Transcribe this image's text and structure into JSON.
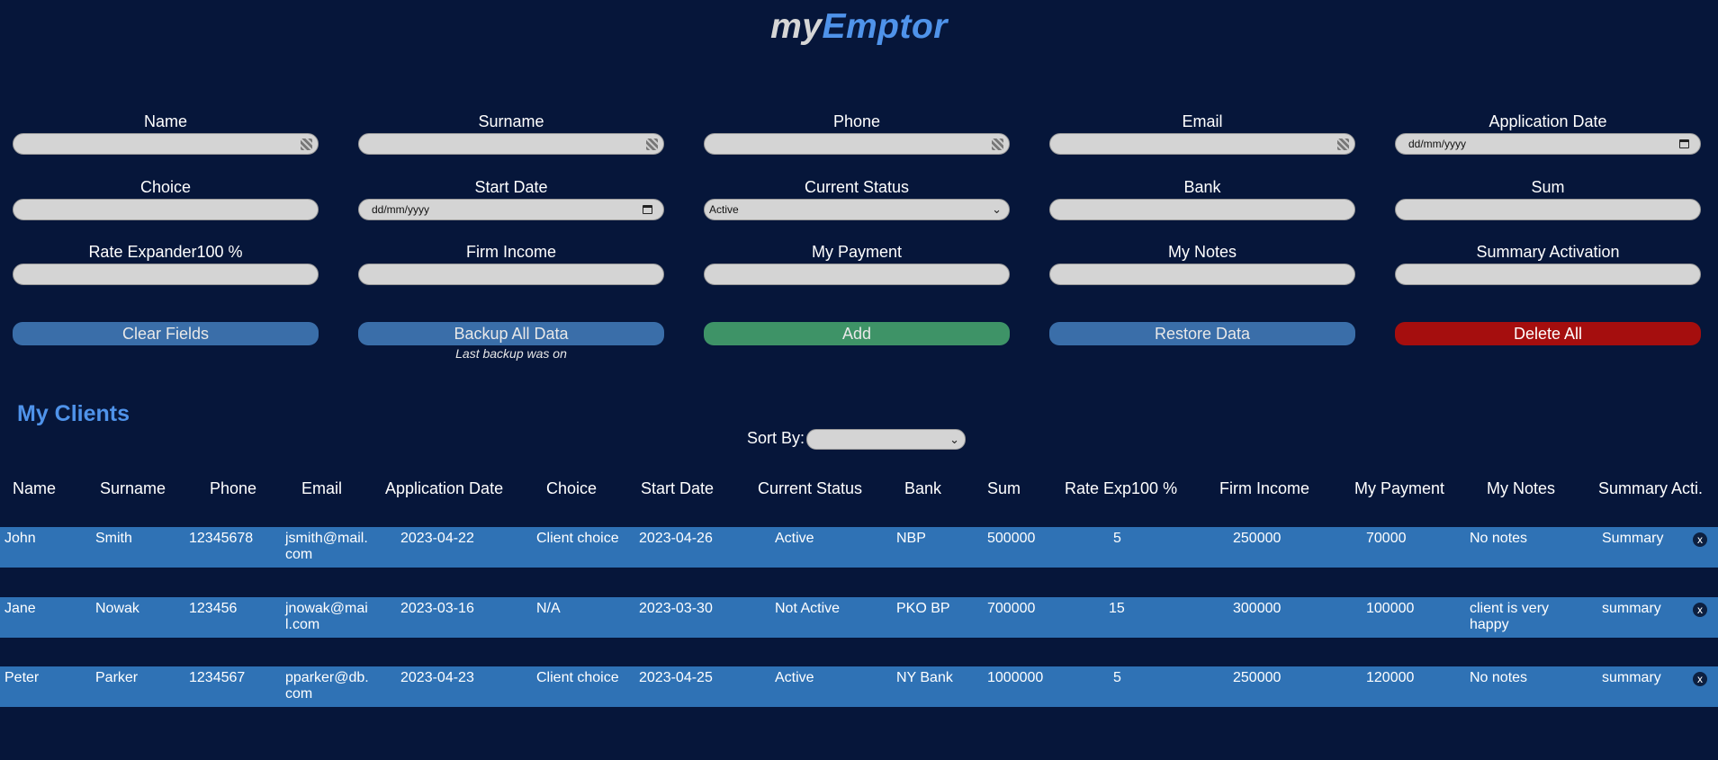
{
  "app": {
    "title_my": "my",
    "title_emptor": "Emptor"
  },
  "form": {
    "fields": [
      {
        "label": "Name",
        "value": "",
        "kind": "autofill"
      },
      {
        "label": "Surname",
        "value": "",
        "kind": "autofill"
      },
      {
        "label": "Phone",
        "value": "",
        "kind": "autofill"
      },
      {
        "label": "Email",
        "value": "",
        "kind": "autofill"
      },
      {
        "label": "Application Date",
        "value": "dd/mm/yyyy",
        "kind": "date"
      },
      {
        "label": "Choice",
        "value": "",
        "kind": "text"
      },
      {
        "label": "Start Date",
        "value": "dd/mm/yyyy",
        "kind": "date"
      },
      {
        "label": "Current Status",
        "value": "Active",
        "kind": "select"
      },
      {
        "label": "Bank",
        "value": "",
        "kind": "text"
      },
      {
        "label": "Sum",
        "value": "",
        "kind": "text"
      },
      {
        "label": "Rate Expander100 %",
        "value": "",
        "kind": "text"
      },
      {
        "label": "Firm Income",
        "value": "",
        "kind": "text"
      },
      {
        "label": "My Payment",
        "value": "",
        "kind": "text"
      },
      {
        "label": "My Notes",
        "value": "",
        "kind": "text"
      },
      {
        "label": "Summary Activation",
        "value": "",
        "kind": "text"
      }
    ],
    "buttons": {
      "clear": "Clear Fields",
      "backup": "Backup All Data",
      "add": "Add",
      "restore": "Restore Data",
      "delete_all": "Delete All"
    },
    "backup_note": "Last backup was on"
  },
  "clients": {
    "title": "My Clients",
    "sort_label": "Sort By:",
    "sort_value": "",
    "columns": [
      "Name",
      "Surname",
      "Phone",
      "Email",
      "Application Date",
      "Choice",
      "Start Date",
      "Current Status",
      "Bank",
      "Sum",
      "Rate Exp100 %",
      "Firm Income",
      "My Payment",
      "My Notes",
      "Summary Acti."
    ],
    "rows": [
      {
        "name": "John",
        "surname": "Smith",
        "phone": "12345678",
        "email_1": "jsmith@mail.",
        "email_2": "com",
        "app_date": "2023-04-22",
        "choice": "Client choice",
        "start_date": "2023-04-26",
        "status": "Active",
        "bank": "NBP",
        "sum": "500000",
        "rate": "5",
        "firm_income": "250000",
        "my_payment": "70000",
        "notes_1": "No notes",
        "notes_2": "",
        "summary": "Summary",
        "delete": "x"
      },
      {
        "name": "Jane",
        "surname": "Nowak",
        "phone": "123456",
        "email_1": "jnowak@mai",
        "email_2": "l.com",
        "app_date": "2023-03-16",
        "choice": "N/A",
        "start_date": "2023-03-30",
        "status": "Not Active",
        "bank": "PKO BP",
        "sum": "700000",
        "rate": "15",
        "firm_income": "300000",
        "my_payment": "100000",
        "notes_1": "client is very",
        "notes_2": "happy",
        "summary": "summary",
        "delete": "x"
      },
      {
        "name": "Peter",
        "surname": "Parker",
        "phone": "1234567",
        "email_1": "pparker@db.",
        "email_2": "com",
        "app_date": "2023-04-23",
        "choice": "Client choice",
        "start_date": "2023-04-25",
        "status": "Active",
        "bank": "NY Bank",
        "sum": "1000000",
        "rate": "5",
        "firm_income": "250000",
        "my_payment": "120000",
        "notes_1": "No notes",
        "notes_2": "",
        "summary": "summary",
        "delete": "x"
      }
    ]
  },
  "colors": {
    "background": "#06163a",
    "accent": "#4f93ea",
    "row": "#2f72b5",
    "add": "#3e9367",
    "danger": "#a50e0e"
  }
}
